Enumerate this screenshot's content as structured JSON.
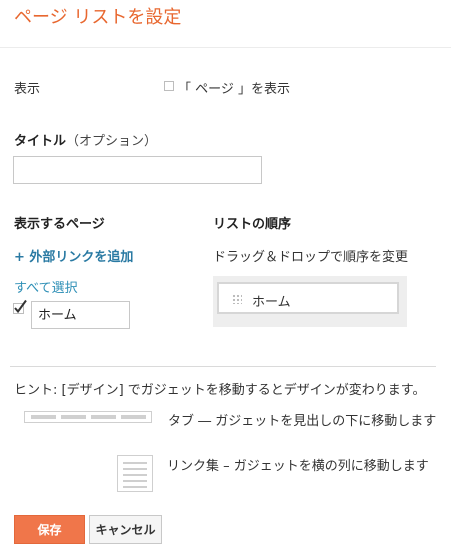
{
  "dialog": {
    "title": "ページ リストを設定"
  },
  "display": {
    "label": "表示",
    "show_pages_checkbox_label": "「 ページ 」を表示"
  },
  "title_field": {
    "label": "タイトル",
    "optional_note": "（オプション）",
    "value": ""
  },
  "pages_section": {
    "heading": "表示するページ",
    "add_external_link": "+ 外部リンクを追加",
    "select_all": "すべて選択",
    "pages": [
      {
        "label": "ホーム",
        "checked": true
      }
    ]
  },
  "order_section": {
    "heading": "リストの順序",
    "instruction": "ドラッグ＆ドロップで順序を変更",
    "items": [
      {
        "label": "ホーム"
      }
    ]
  },
  "hint": {
    "text": "ヒント: [デザイン] でガジェットを移動するとデザインが変わります。",
    "tab_layout": "タブ ― ガジェットを見出しの下に移動します",
    "list_layout": "リンク集 – ガジェットを横の列に移動します"
  },
  "buttons": {
    "save": "保存",
    "cancel": "キャンセル"
  },
  "colors": {
    "accent": "#e8672f",
    "save_button": "#f0764a",
    "link": "#2e8fb6"
  }
}
